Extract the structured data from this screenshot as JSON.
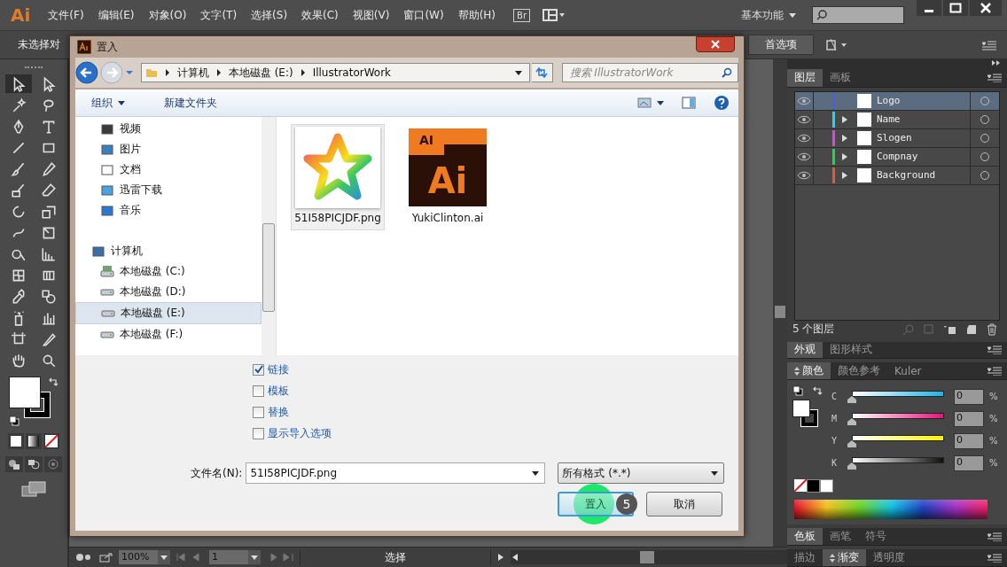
{
  "app": {
    "logo": "Ai",
    "menu": [
      "文件(F)",
      "编辑(E)",
      "对象(O)",
      "文字(T)",
      "选择(S)",
      "效果(C)",
      "视图(V)",
      "窗口(W)",
      "帮助(H)"
    ],
    "bridge": "Br",
    "workspace": "基本功能"
  },
  "control_bar": {
    "selection_status": "未选择对",
    "preferences_button": "首选项"
  },
  "layers_panel": {
    "tabs": [
      {
        "label": "图层",
        "selected": true
      },
      {
        "label": "画板",
        "selected": false
      }
    ],
    "layers": [
      {
        "name": "Logo",
        "color": "#4a5ee8",
        "selected": true,
        "has_sublayers": false
      },
      {
        "name": "Name",
        "color": "#22d8e8",
        "selected": false,
        "has_sublayers": true
      },
      {
        "name": "Slogen",
        "color": "#d848e0",
        "selected": false,
        "has_sublayers": true
      },
      {
        "name": "Compnay",
        "color": "#22d84a",
        "selected": false,
        "has_sublayers": true
      },
      {
        "name": "Background",
        "color": "#e05a3a",
        "selected": false,
        "has_sublayers": true
      }
    ],
    "count": "5 个图层"
  },
  "appearance_panel": {
    "tabs": [
      {
        "label": "外观",
        "selected": true
      },
      {
        "label": "图形样式",
        "selected": false
      }
    ]
  },
  "color_panel": {
    "tabs": [
      {
        "label": "颜色",
        "selected": true,
        "resizable": true
      },
      {
        "label": "颜色参考",
        "selected": false,
        "resizable": false
      },
      {
        "label": "Kuler",
        "selected": false,
        "resizable": false
      }
    ],
    "channels": [
      {
        "name": "C",
        "kind": "cyan",
        "level": 0,
        "value": "0",
        "unit": "%"
      },
      {
        "name": "M",
        "kind": "magenta",
        "level": 0,
        "value": "0",
        "unit": "%"
      },
      {
        "name": "Y",
        "kind": "yellow",
        "level": 0,
        "value": "0",
        "unit": "%"
      },
      {
        "name": "K",
        "kind": "black",
        "level": 0,
        "value": "0",
        "unit": "%"
      }
    ]
  },
  "swatches_panel": {
    "tabs": [
      {
        "label": "色板",
        "selected": true,
        "resizable": false
      },
      {
        "label": "画笔",
        "selected": false,
        "resizable": false
      },
      {
        "label": "符号",
        "selected": false,
        "resizable": false
      }
    ]
  },
  "stroke_panel": {
    "tabs": [
      {
        "label": "描边",
        "selected": false,
        "resizable": false
      },
      {
        "label": "渐变",
        "selected": true,
        "resizable": true
      },
      {
        "label": "透明度",
        "selected": false,
        "resizable": false
      }
    ]
  },
  "status_bar": {
    "zoom": "100%",
    "artboard": "1",
    "tool": "选择"
  },
  "dialog": {
    "title": "置入",
    "path": [
      "计算机",
      "本地磁盘 (E:)",
      "IllustratorWork"
    ],
    "search_placeholder": "搜索 IllustratorWork",
    "organize": "组织",
    "new_folder": "新建文件夹",
    "nav": [
      {
        "label": "视频",
        "kind": "video",
        "selected": false
      },
      {
        "label": "图片",
        "kind": "pictures",
        "selected": false
      },
      {
        "label": "文档",
        "kind": "documents",
        "selected": false
      },
      {
        "label": "迅雷下载",
        "kind": "download",
        "selected": false
      },
      {
        "label": "音乐",
        "kind": "music",
        "selected": false
      },
      {
        "label": "计算机",
        "kind": "computer",
        "selected": false,
        "children": [
          {
            "label": "本地磁盘 (C:)",
            "kind": "system-drive",
            "selected": false
          },
          {
            "label": "本地磁盘 (D:)",
            "kind": "drive",
            "selected": false
          },
          {
            "label": "本地磁盘 (E:)",
            "kind": "drive",
            "selected": true
          },
          {
            "label": "本地磁盘 (F:)",
            "kind": "drive",
            "selected": false
          }
        ]
      }
    ],
    "files": [
      {
        "name": "51I58PICJDF.png",
        "kind": "image",
        "selected": true
      },
      {
        "name": "YukiClinton.ai",
        "kind": "ai",
        "selected": false,
        "icon_tab": "AI",
        "icon_text": "Ai"
      }
    ],
    "options": [
      {
        "label": "链接",
        "checked": true
      },
      {
        "label": "模板",
        "checked": false
      },
      {
        "label": "替换",
        "checked": false
      },
      {
        "label": "显示导入选项",
        "checked": false
      }
    ],
    "filename_label": "文件名(N):",
    "filename": "51I58PICJDF.png",
    "filetype": "所有格式 (*.*)",
    "place_button": "置入",
    "cancel_button": "取消",
    "step_marker": "5"
  }
}
